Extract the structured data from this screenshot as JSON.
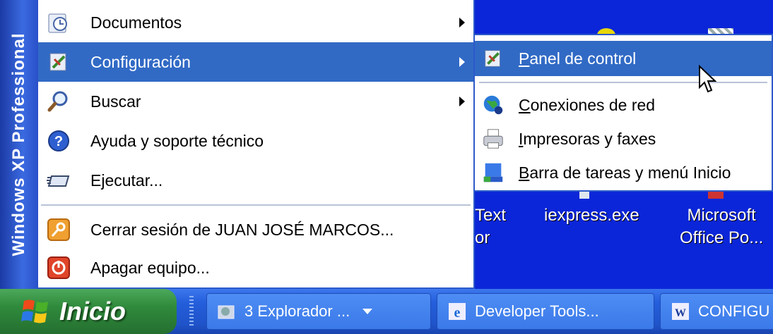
{
  "start_menu": {
    "brand": "Windows XP Professional",
    "items": [
      {
        "label": "Documentos",
        "icon": "documents-icon",
        "has_submenu": true
      },
      {
        "label": "Configuración",
        "icon": "settings-icon",
        "has_submenu": true
      },
      {
        "label": "Buscar",
        "icon": "search-icon",
        "has_submenu": true
      },
      {
        "label": "Ayuda y soporte técnico",
        "icon": "help-icon",
        "has_submenu": false
      },
      {
        "label": "Ejecutar...",
        "icon": "run-icon",
        "has_submenu": false
      },
      {
        "label": "Cerrar sesión de JUAN JOSÉ MARCOS...",
        "icon": "logoff-icon",
        "has_submenu": false
      },
      {
        "label": "Apagar equipo...",
        "icon": "shutdown-icon",
        "has_submenu": false
      }
    ],
    "selected": "Configuración"
  },
  "submenu": {
    "items": [
      {
        "label": "Panel de control",
        "icon": "control-panel-icon"
      },
      {
        "label": "Conexiones de red",
        "icon": "network-connections-icon"
      },
      {
        "label": "Impresoras y faxes",
        "icon": "printers-icon"
      },
      {
        "label": "Barra de tareas y menú Inicio",
        "icon": "taskbar-settings-icon"
      }
    ],
    "selected": "Panel de control"
  },
  "desktop": {
    "icons": [
      {
        "line1": "Text",
        "line2": "or"
      },
      {
        "line1": "iexpress.exe",
        "line2": ""
      },
      {
        "line1": "Microsoft",
        "line2": "Office Po..."
      }
    ]
  },
  "taskbar": {
    "start_label": "Inicio",
    "buttons": [
      {
        "label": "3 Explorador ...",
        "icon": "explorer-group-icon",
        "has_caret": true
      },
      {
        "label": "Developer Tools...",
        "icon": "ie-icon",
        "has_caret": false
      },
      {
        "label": "CONFIGU",
        "icon": "word-icon",
        "has_caret": false
      }
    ]
  },
  "colors": {
    "menu_highlight": "#316ac5",
    "desktop": "#0b26d8",
    "start_button": "#2f8a3c"
  }
}
